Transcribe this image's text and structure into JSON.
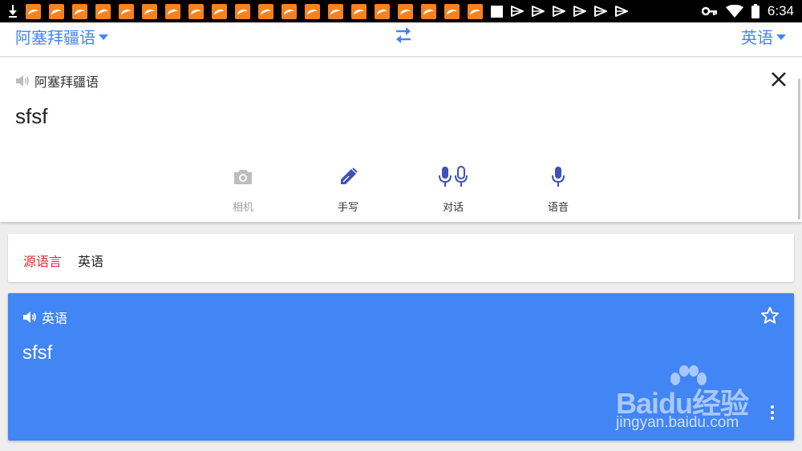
{
  "statusbar": {
    "time": "6:34",
    "notification_icons": [
      "download-icon",
      "app-icon",
      "app-icon",
      "app-icon",
      "app-icon",
      "app-icon",
      "app-icon",
      "app-icon",
      "app-icon",
      "app-icon",
      "app-icon",
      "app-icon",
      "app-icon",
      "app-icon",
      "app-icon",
      "app-icon",
      "app-icon",
      "app-icon",
      "app-icon",
      "app-icon",
      "app-icon",
      "square-icon",
      "play-store-icon",
      "play-store-icon",
      "play-store-icon",
      "play-store-icon",
      "play-store-icon",
      "play-store-icon"
    ],
    "system_icons": [
      "key-icon",
      "wifi-icon",
      "battery-icon"
    ]
  },
  "langbar": {
    "source_language": "阿塞拜疆语",
    "target_language": "英语",
    "accent_color": "#4285f4"
  },
  "input": {
    "language_label": "阿塞拜疆语",
    "text": "sfsf",
    "tools": [
      {
        "label": "相机",
        "icon": "camera-icon",
        "enabled": false
      },
      {
        "label": "手写",
        "icon": "pen-icon",
        "enabled": true
      },
      {
        "label": "对话",
        "icon": "conversation-mic-icon",
        "enabled": true
      },
      {
        "label": "语音",
        "icon": "mic-icon",
        "enabled": true
      }
    ]
  },
  "source_chip": {
    "label": "源语言",
    "value": "英语",
    "label_color": "#d32f2f"
  },
  "result": {
    "language_label": "英语",
    "text": "sfsf",
    "background_color": "#4285f4"
  },
  "watermark": {
    "brand": "Baidu经验",
    "url": "jingyan.baidu.com"
  }
}
